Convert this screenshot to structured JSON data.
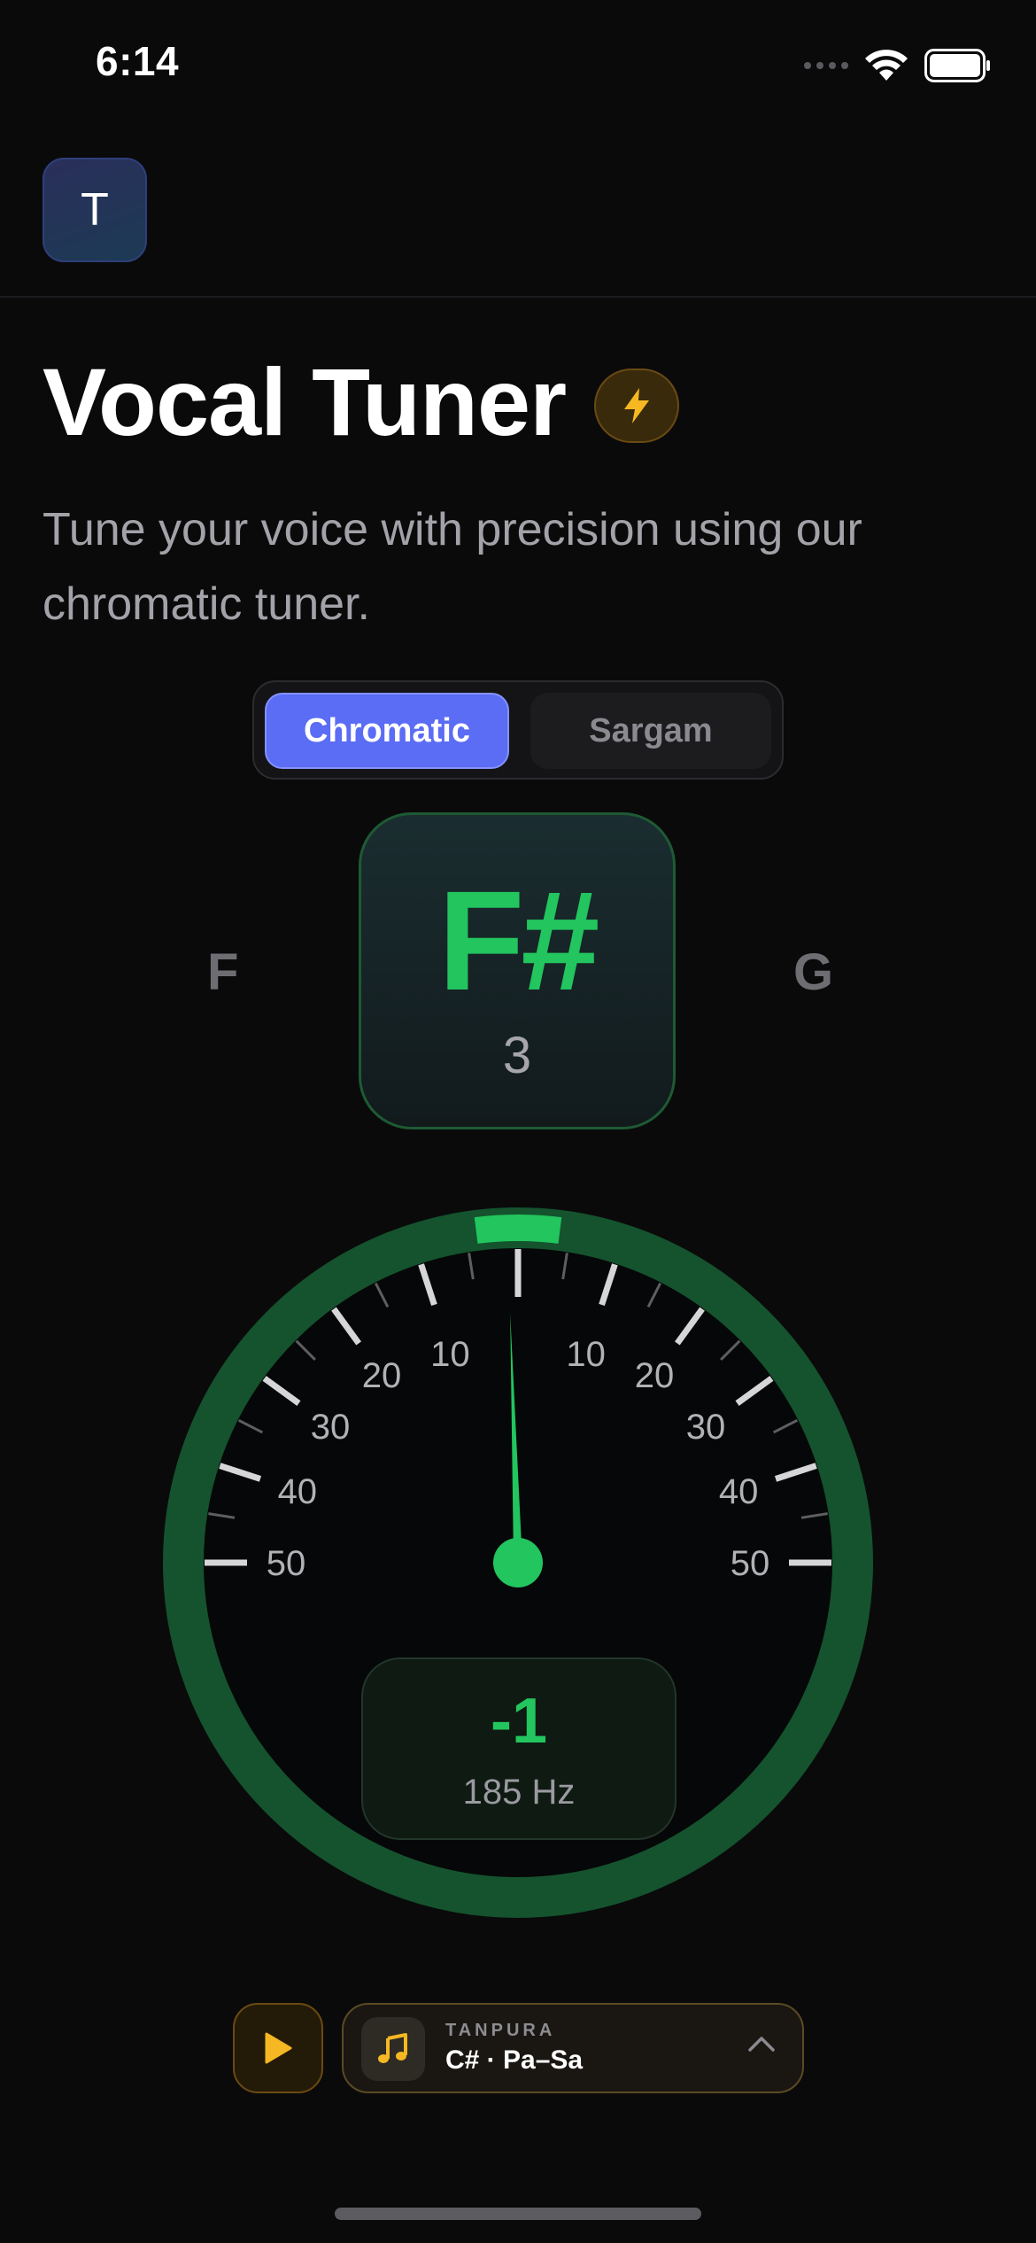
{
  "status_bar": {
    "time": "6:14"
  },
  "header": {
    "avatar_letter": "T"
  },
  "page": {
    "title": "Vocal Tuner",
    "description": "Tune your voice with precision using our chromatic tuner."
  },
  "mode_toggle": {
    "options": [
      "Chromatic",
      "Sargam"
    ],
    "selected": "Chromatic"
  },
  "tuner": {
    "prev_note": "F",
    "current_note": "F#",
    "octave": "3",
    "next_note": "G",
    "cents": -1,
    "cents_label": "-1",
    "frequency": "185 Hz",
    "scale_labels": [
      "50",
      "40",
      "30",
      "20",
      "10",
      "10",
      "20",
      "30",
      "40",
      "50"
    ],
    "in_tune_color": "#22c55e"
  },
  "tanpura": {
    "label": "TANPURA",
    "value": "C# · Pa–Sa"
  },
  "colors": {
    "accent": "#5b6cf5",
    "success": "#22c55e",
    "warning": "#f5b823"
  }
}
